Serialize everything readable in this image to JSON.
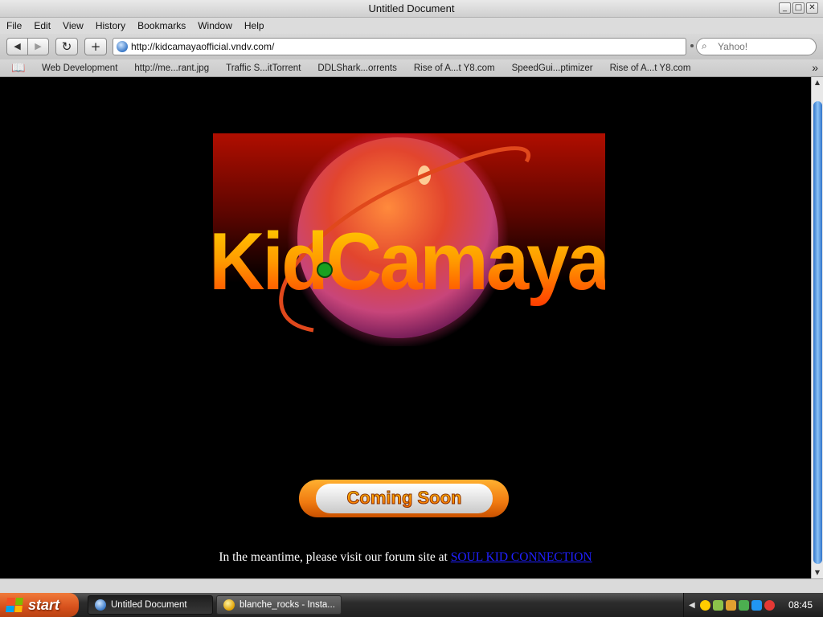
{
  "window": {
    "title": "Untitled Document",
    "buttons": {
      "minimize": "_",
      "maximize": "□",
      "close": "✕"
    }
  },
  "menu": [
    "File",
    "Edit",
    "View",
    "History",
    "Bookmarks",
    "Window",
    "Help"
  ],
  "toolbar": {
    "back_icon": "◀",
    "forward_icon": "▶",
    "reload_icon": "↻",
    "add_icon": "+",
    "url": "http://kidcamayaofficial.vndv.com/",
    "search_placeholder": "Yahoo!"
  },
  "bookmarks": {
    "items": [
      "Web Development",
      "http://me...rant.jpg",
      "Traffic S...itTorrent",
      "DDLShark...orrents",
      "Rise of A...t Y8.com",
      "SpeedGui...ptimizer",
      "Rise of A...t Y8.com"
    ],
    "more_icon": "»"
  },
  "page": {
    "logo_text": "KidCamaya",
    "coming_soon": "Coming Soon",
    "meantime_text": "In the meantime, please visit our forum site at ",
    "forum_link": "SOUL KID CONNECTION"
  },
  "taskbar": {
    "start_label": "start",
    "tasks": [
      {
        "label": "Untitled Document",
        "active": true
      },
      {
        "label": "blanche_rocks - Insta...",
        "active": false
      }
    ],
    "clock": "08:45"
  },
  "colors": {
    "logo_gradient_top": "#ffd000",
    "logo_gradient_bottom": "#ff3c00",
    "orb": "#d83a5a",
    "link": "#2020ff",
    "scroll_thumb": "#3a82d8",
    "start_button": "#e2632a"
  }
}
